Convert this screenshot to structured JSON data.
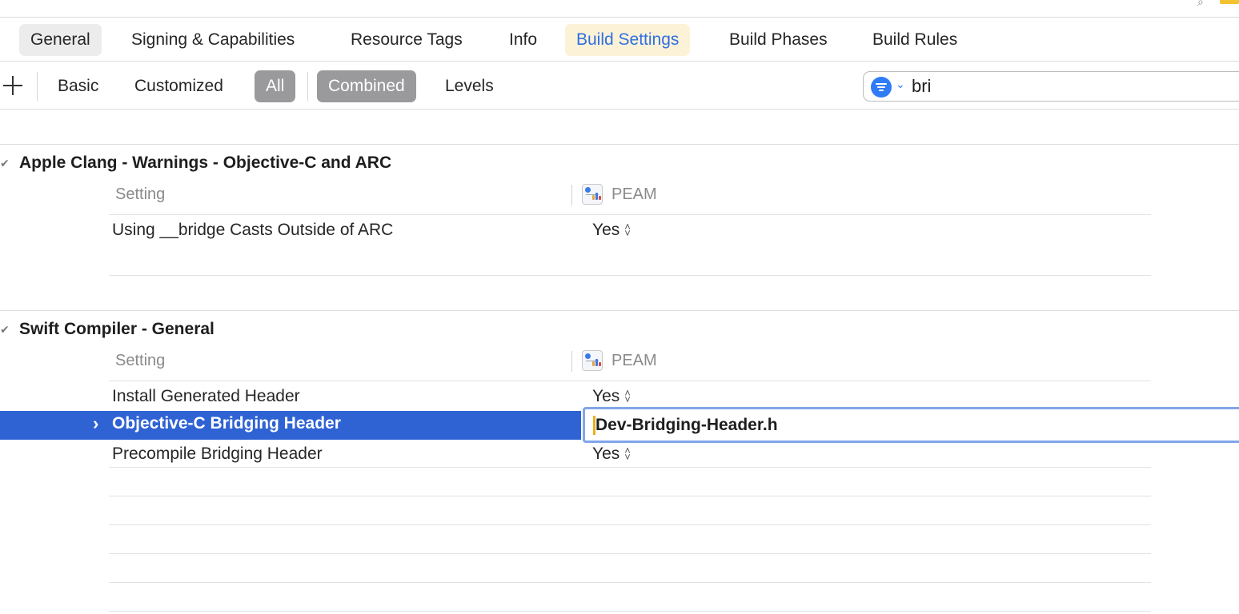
{
  "tabs": [
    {
      "label": "General"
    },
    {
      "label": "Signing & Capabilities"
    },
    {
      "label": "Resource Tags"
    },
    {
      "label": "Info"
    },
    {
      "label": "Build Settings",
      "selected": true
    },
    {
      "label": "Build Phases"
    },
    {
      "label": "Build Rules"
    }
  ],
  "filter_bar": {
    "scope": [
      "Basic",
      "Customized",
      "All"
    ],
    "scope_selected": "All",
    "view": [
      "Combined",
      "Levels"
    ],
    "view_selected": "Combined"
  },
  "search": {
    "value": "bri"
  },
  "sections": [
    {
      "title": "Apple Clang - Warnings - Objective-C and ARC",
      "column_setting": "Setting",
      "column_target": "PEAM",
      "rows": [
        {
          "setting": "Using __bridge Casts Outside of ARC",
          "value": "Yes"
        }
      ]
    },
    {
      "title": "Swift Compiler - General",
      "column_setting": "Setting",
      "column_target": "PEAM",
      "rows": [
        {
          "setting": "Install Generated Header",
          "value": "Yes"
        },
        {
          "setting": "Objective-C Bridging Header",
          "value": "Dev-Bridging-Header.h",
          "selected": true,
          "editing": true
        },
        {
          "setting": "Precompile Bridging Header",
          "value": "Yes"
        }
      ]
    }
  ],
  "colors": {
    "accent": "#2f7cf6",
    "selection": "#2f63d4",
    "selected_tab_bg": "#fcf2d8",
    "selected_tab_text": "#2f6fe0",
    "segment_on": "#9a9a9c"
  },
  "icons": {
    "add": "plus-icon",
    "filter": "filter-icon",
    "disclosure": "chevron-right-icon",
    "section_toggle": "checkmark-icon",
    "target": "target-app-icon",
    "stepper": "up-down-chevron-icon"
  }
}
